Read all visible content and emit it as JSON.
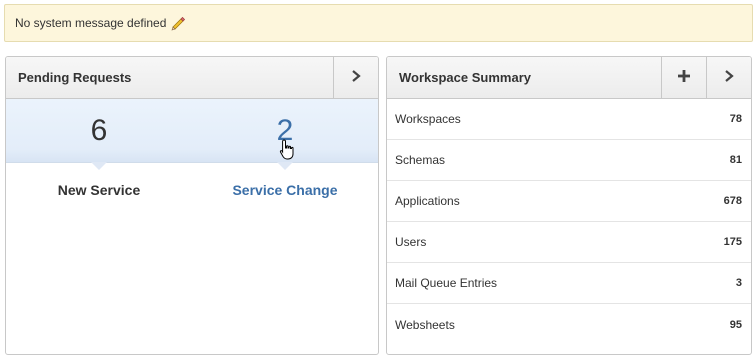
{
  "system_message": {
    "text": "No system message defined",
    "edit_icon": "pencil-icon"
  },
  "pending_requests": {
    "title": "Pending Requests",
    "nav_icon": "chevron-right-icon",
    "items": [
      {
        "value": "6",
        "label": "New Service"
      },
      {
        "value": "2",
        "label": "Service Change"
      }
    ]
  },
  "workspace_summary": {
    "title": "Workspace Summary",
    "add_icon": "plus-icon",
    "nav_icon": "chevron-right-icon",
    "rows": [
      {
        "label": "Workspaces",
        "value": "78"
      },
      {
        "label": "Schemas",
        "value": "81"
      },
      {
        "label": "Applications",
        "value": "678"
      },
      {
        "label": "Users",
        "value": "175"
      },
      {
        "label": "Mail Queue Entries",
        "value": "3"
      },
      {
        "label": "Websheets",
        "value": "95"
      }
    ]
  },
  "colors": {
    "message_bg": "#fdf6dc",
    "link": "#3b6fa8",
    "badge_bg": "#e3edf9"
  }
}
